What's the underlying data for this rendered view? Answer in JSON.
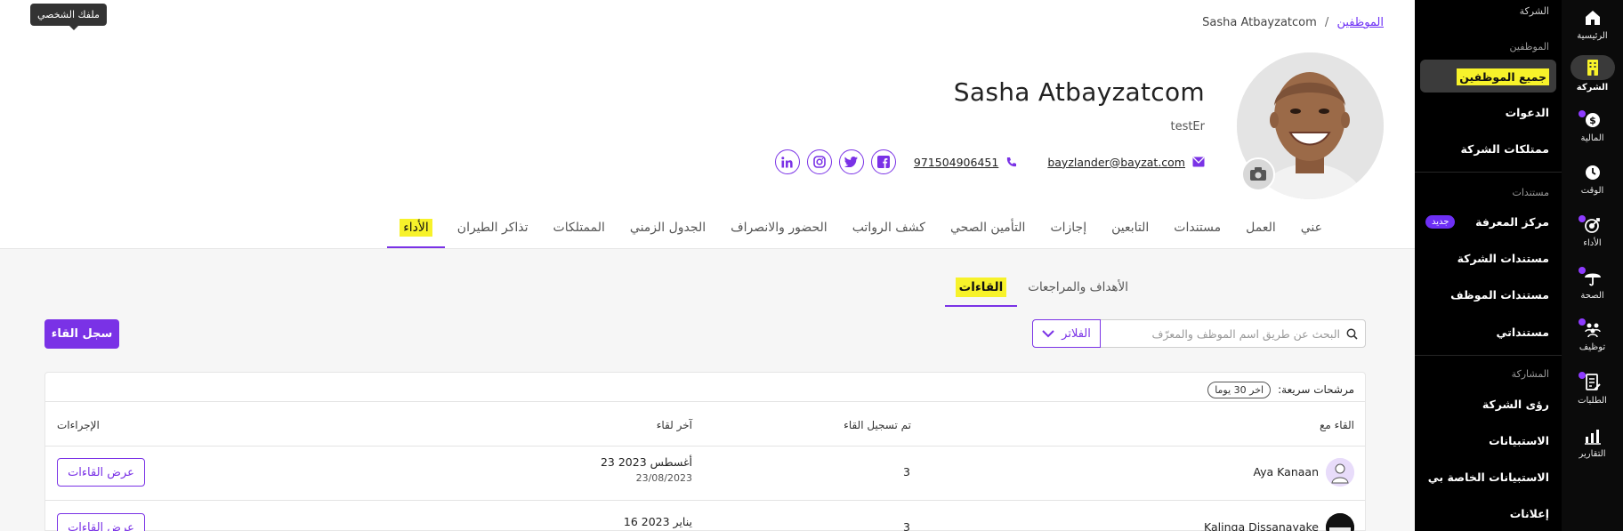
{
  "tooltip": "ملفك الشخصي",
  "rail": [
    {
      "label": "الرئيسية",
      "icon": "home-icon"
    },
    {
      "label": "الشركة",
      "icon": "building-icon",
      "active": true
    },
    {
      "label": "المالية",
      "icon": "dollar-icon"
    },
    {
      "label": "الوقت",
      "icon": "clock-icon"
    },
    {
      "label": "الأداء",
      "icon": "target-icon"
    },
    {
      "label": "الصحة",
      "icon": "umbrella-icon"
    },
    {
      "label": "توظيف",
      "icon": "people-icon"
    },
    {
      "label": "الطلبات",
      "icon": "request-icon"
    },
    {
      "label": "التقارير",
      "icon": "chart-icon"
    }
  ],
  "subnav": {
    "company_label": "الشركة",
    "sections": {
      "employees": "الموظفين",
      "documents": "مستندات",
      "engagement": "المشاركة"
    },
    "items": {
      "all_employees": "جميع الموظفين",
      "invitations": "الدعوات",
      "company_assets": "ممتلكات الشركة",
      "knowledge_center": "مركز المعرفة",
      "new_badge": "جديد",
      "company_documents": "مستندات الشركة",
      "employee_documents": "مستندات الموظف",
      "my_documents": "مستنداتي",
      "company_insights": "رؤى الشركة",
      "surveys": "الاستبيانات",
      "my_surveys": "الاستبيانات الخاصة بي",
      "announcements": "إعلانات"
    }
  },
  "breadcrumb": {
    "link": "الموظفين",
    "separator": "/",
    "current": "Sasha Atbayzatcom"
  },
  "profile": {
    "name": "Sasha Atbayzatcom",
    "title": "testEr",
    "email": "bayzlander@bayzat.com",
    "phone": "971504906451",
    "socials": [
      "facebook-icon",
      "twitter-icon",
      "instagram-icon",
      "linkedin-icon"
    ]
  },
  "tabs": [
    "عني",
    "العمل",
    "مستندات",
    "التابعين",
    "إجازات",
    "التأمين الصحي",
    "كشف الرواتب",
    "الحضور والانصراف",
    "الجدول الزمني",
    "الممتلكات",
    "تذاكر الطيران",
    "الأداء"
  ],
  "active_tab": "الأداء",
  "subtabs": [
    "الأهداف والمراجعات",
    "القاءات"
  ],
  "active_subtab": "القاءات",
  "search": {
    "placeholder": "البحث عن طريق اسم الموظف والمعرّف",
    "value": ""
  },
  "filters_label": "الفلاتر",
  "log_button": "سجل القاء",
  "quick_filters": {
    "label": "مرشحات سريعة:",
    "chip": "اخر 30 يوما"
  },
  "table": {
    "columns": {
      "with": "القاء مع",
      "logged": "تم تسجيل القاء",
      "last": "آخر لقاء",
      "actions": "الإجراءات"
    },
    "rows": [
      {
        "name": "Aya Kanaan",
        "count": "3",
        "last_date": "23 أغسطس 2023",
        "last_date_sub": "23/08/2023",
        "action": "عرض القاءات"
      },
      {
        "name": "Kalinga Dissanayake",
        "count": "3",
        "last_date": "16 يناير 2023",
        "last_date_sub": "",
        "action": "عرض القاءات"
      }
    ]
  },
  "colors": {
    "accent": "#7a32e6",
    "highlight": "#f7f22a",
    "sidebar": "#000000"
  }
}
